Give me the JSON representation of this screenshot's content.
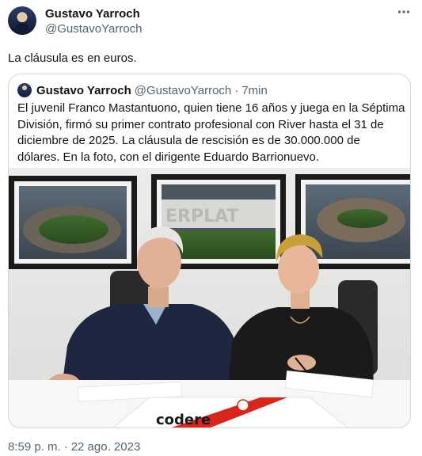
{
  "tweet": {
    "author_name": "Gustavo Yarroch",
    "author_handle": "@GustavoYarroch",
    "more_icon": "more-horizontal-icon",
    "text": "La cláusula es en euros.",
    "time": "8:59 p. m.",
    "date": "22 ago. 2023",
    "separator": "·"
  },
  "quote": {
    "author_name": "Gustavo Yarroch",
    "author_handle": "@GustavoYarroch",
    "separator": "·",
    "time": "7min",
    "text": "El juvenil Franco Mastantuono, quien tiene 16 años y juega en la Séptima División, firmó su primer contrato profesional con River hasta el 31 de diciembre de 2025. La cláusula de rescisión es de 30.000.000 de dólares. En la foto, con el dirigente Eduardo Barrionuevo.",
    "photo": {
      "banner_text": "ERPLAT",
      "shirt_sponsor": "codere"
    }
  },
  "colors": {
    "text_primary": "#0f1419",
    "text_secondary": "#536471",
    "border": "#cfd9de",
    "river_red": "#d9261c"
  }
}
